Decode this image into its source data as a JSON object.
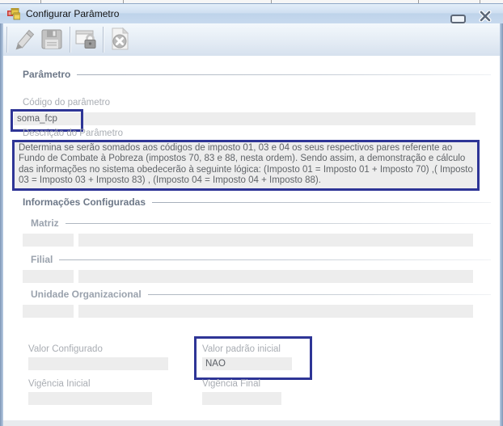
{
  "window": {
    "title": "Configurar Parâmetro",
    "icon": "winforms-app-icon",
    "controls": {
      "minimize": "minimize-icon",
      "close": "close-icon"
    }
  },
  "toolbar": {
    "buttons": [
      {
        "name": "edit",
        "icon": "pencil-icon",
        "enabled": false
      },
      {
        "name": "save",
        "icon": "save-icon",
        "enabled": false
      },
      {
        "name": "unlock",
        "icon": "lock-icon",
        "enabled": true
      },
      {
        "name": "cancel",
        "icon": "cancel-icon",
        "enabled": false
      }
    ]
  },
  "parametro": {
    "section_title": "Parâmetro",
    "codigo_label": "Código do parâmetro",
    "codigo_value": "soma_fcp",
    "descricao_label": "Descrição do Parâmetro",
    "descricao_value": "Determina se serão somados aos códigos de imposto 01, 03 e 04 os seus respectivos pares referente ao Fundo de Combate à Pobreza (impostos 70, 83 e 88, nesta ordem). Sendo assim, a demonstração e cálculo das informações no sistema obedecerão à seguinte lógica: (Imposto 01 = Imposto 01 + Imposto 70) ,( Imposto 03 = Imposto 03 + Imposto 83) , (Imposto 04 = Imposto 04 + Imposto 88)."
  },
  "informacoes": {
    "section_title": "Informações Configuradas",
    "matriz_label": "Matriz",
    "matriz_codigo": "",
    "matriz_nome": "",
    "filial_label": "Filial",
    "filial_codigo": "",
    "filial_nome": "",
    "unidade_label": "Unidade Organizacional",
    "unidade_codigo": "",
    "unidade_nome": "",
    "valor_configurado_label": "Valor Configurado",
    "valor_configurado_value": "",
    "valor_padrao_label": "Valor padrão inicial",
    "valor_padrao_value": "NAO",
    "vigencia_inicial_label": "Vigência Inicial",
    "vigencia_inicial_value": "",
    "vigencia_final_label": "Vigência Final",
    "vigencia_final_value": ""
  },
  "colors": {
    "annotation_blue": "#2e3596",
    "titlebar_blue": "#c7d9ee",
    "field_gray": "#ededed"
  }
}
